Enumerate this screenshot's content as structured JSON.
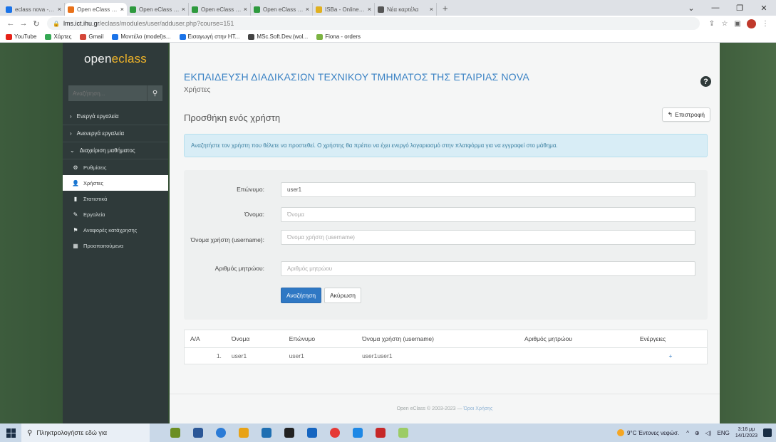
{
  "browser": {
    "tabs": [
      {
        "title": "eclass nova - κατηγορ...",
        "color": "#1a73e8",
        "active": false
      },
      {
        "title": "Open eClass | ΕΚΠΑΙΔ...",
        "color": "#e8711a",
        "active": true
      },
      {
        "title": "Open eClass Docume...",
        "color": "#2e9a3e",
        "active": false
      },
      {
        "title": "Open eClass Docume...",
        "color": "#2e9a3e",
        "active": false
      },
      {
        "title": "Open eClass Docume...",
        "color": "#2e9a3e",
        "active": false
      },
      {
        "title": "ISBa - Online Suppo...",
        "color": "#e0b020",
        "active": false
      },
      {
        "title": "Νέα καρτέλα",
        "color": "#555555",
        "active": false
      }
    ],
    "new_tab": "+",
    "url_host": "lms.ict.ihu.gr",
    "url_path": "/eclass/modules/user/adduser.php?course=151",
    "bookmarks": [
      {
        "label": "YouTube",
        "color": "#e62117"
      },
      {
        "label": "Χάρτες",
        "color": "#34a853"
      },
      {
        "label": "Gmail",
        "color": "#d44638"
      },
      {
        "label": "Μοντέλο (model)s...",
        "color": "#1a73e8"
      },
      {
        "label": "Εισαγωγή στην HT...",
        "color": "#1a73e8"
      },
      {
        "label": "MSc.Soft.Dev.(wol...",
        "color": "#444444"
      },
      {
        "label": "Fiona - orders",
        "color": "#7cb342"
      }
    ]
  },
  "sidebar": {
    "logo_open": "open ",
    "logo_eclass": "eclass",
    "search_placeholder": "Αναζήτηση...",
    "sections": [
      {
        "label": "Ενεργά εργαλεία",
        "chevron": "›"
      },
      {
        "label": "Ανενεργά εργαλεία",
        "chevron": "›"
      },
      {
        "label": "Διαχείριση μαθήματος",
        "chevron": "⌄"
      }
    ],
    "items": [
      {
        "label": "Ρυθμίσεις",
        "icon": "⚙",
        "active": false
      },
      {
        "label": "Χρήστες",
        "icon": "👤",
        "active": true
      },
      {
        "label": "Στατιστικά",
        "icon": "▮",
        "active": false
      },
      {
        "label": "Εργαλεία",
        "icon": "✎",
        "active": false
      },
      {
        "label": "Αναφορές κατάχρησης",
        "icon": "⚑",
        "active": false
      },
      {
        "label": "Προαπαιτούμενα",
        "icon": "▦",
        "active": false
      }
    ]
  },
  "main": {
    "course_title": "ΕΚΠΑΙΔΕΥΣΗ ΔΙΑΔΙΚΑΣΙΩΝ ΤΕΧΝΙΚΟΥ ΤΜΗΜΑΤΟΣ ΤΗΣ ΕΤΑΙΡΙΑΣ NOVA",
    "breadcrumb": "Χρήστες",
    "help": "?",
    "page_heading": "Προσθήκη ενός χρήστη",
    "back_label": "Επιστροφή",
    "alert": "Αναζητήστε τον χρήστη που θέλετε να προστεθεί. Ο χρήστης θα πρέπει να έχει ενεργό λογαριασμό στην πλατφόρμα για να εγγραφεί στο μάθημα.",
    "form": {
      "surname_label": "Επώνυμο:",
      "surname_value": "user1",
      "name_label": "Όνομα:",
      "name_placeholder": "Όνομα",
      "username_label": "Όνομα χρήστη (username):",
      "username_placeholder": "Όνομα χρήστη (username)",
      "am_label": "Αριθμός μητρώου:",
      "am_placeholder": "Αριθμός μητρώου",
      "search_btn": "Αναζήτηση",
      "cancel_btn": "Ακύρωση"
    },
    "results": {
      "headers": [
        "Α/Α",
        "Όνομα",
        "Επώνυμο",
        "Όνομα χρήστη (username)",
        "Αριθμός μητρώου",
        "Ενέργειες"
      ],
      "rows": [
        {
          "num": "1.",
          "name": "user1",
          "surname": "user1",
          "username": "user1user1",
          "am": "",
          "action_icon": "+"
        }
      ]
    },
    "footer_text": "Open eClass © 2003-2023 —",
    "footer_link": "Όροι Χρήσης"
  },
  "taskbar": {
    "search_placeholder": "Πληκτρολογήστε εδώ για",
    "weather": "9°C Έντονες νεφώσ.",
    "lang": "ENG",
    "time": "3:16 μμ",
    "date": "14/1/2023"
  }
}
